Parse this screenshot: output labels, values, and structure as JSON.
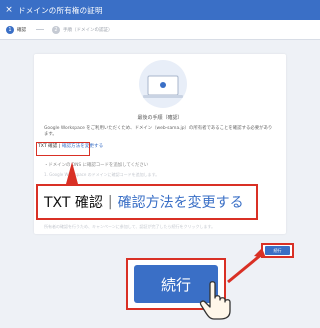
{
  "header": {
    "close_label": "×",
    "title": "ドメインの所有権の証明"
  },
  "stepper": {
    "steps": [
      {
        "num": "1",
        "label": "確認"
      },
      {
        "num": "2",
        "label": "手順（ドメインの認証）"
      }
    ]
  },
  "card": {
    "title": "最後の手順（確認）",
    "description": "Google Workspace をご利用いただくため、ドメイン（web-sama.jp）の所有者であることを確認する必要があります。",
    "txt_label": "TXT 確認",
    "txt_sep": "|",
    "txt_link": "確認方法を変更する",
    "bullet_1": "・ドメインの DNS に確認コードを追加してください",
    "faint_1": "1. Google Workspace のドメインに確認コードを追加します。",
    "faint_2": "所有者の確認を行うため、キャンペーンに参加して、認証が完了したら続行をクリックします。"
  },
  "callout": {
    "label": "TXT 確認",
    "separator": "|",
    "link": "確認方法を変更する"
  },
  "buttons": {
    "continue_small": "続行",
    "continue_big": "続行"
  },
  "colors": {
    "primary": "#3a6fc6",
    "highlight": "#d93025",
    "background": "#eef1f6"
  }
}
